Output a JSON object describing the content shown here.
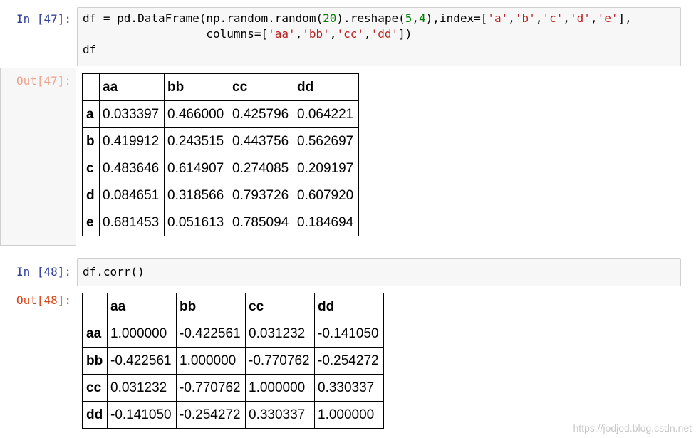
{
  "cell47": {
    "in_prompt": "In [47]:",
    "out_prompt": "Out[47]:",
    "code": {
      "l1_a": "df = pd.DataFrame(np.random.random(",
      "l1_num": "20",
      "l1_b": ").reshape(",
      "l1_n5": "5",
      "l1_comma": ",",
      "l1_n4": "4",
      "l1_c": "),index=[",
      "l1_sa": "'a'",
      "l1_s1": ",",
      "l1_sb": "'b'",
      "l1_s2": ",",
      "l1_sc": "'c'",
      "l1_s3": ",",
      "l1_sd": "'d'",
      "l1_s4": ",",
      "l1_se": "'e'",
      "l1_end": "],",
      "l2_a": "                  columns=[",
      "l2_aa": "'aa'",
      "l2_c1": ",",
      "l2_bb": "'bb'",
      "l2_c2": ",",
      "l2_cc": "'cc'",
      "l2_c3": ",",
      "l2_dd": "'dd'",
      "l2_end": "])",
      "l3": "df"
    },
    "table": {
      "columns": [
        "aa",
        "bb",
        "cc",
        "dd"
      ],
      "rows": [
        {
          "index": "a",
          "values": [
            "0.033397",
            "0.466000",
            "0.425796",
            "0.064221"
          ]
        },
        {
          "index": "b",
          "values": [
            "0.419912",
            "0.243515",
            "0.443756",
            "0.562697"
          ]
        },
        {
          "index": "c",
          "values": [
            "0.483646",
            "0.614907",
            "0.274085",
            "0.209197"
          ]
        },
        {
          "index": "d",
          "values": [
            "0.084651",
            "0.318566",
            "0.793726",
            "0.607920"
          ]
        },
        {
          "index": "e",
          "values": [
            "0.681453",
            "0.051613",
            "0.785094",
            "0.184694"
          ]
        }
      ]
    }
  },
  "cell48": {
    "in_prompt": "In [48]:",
    "out_prompt": "Out[48]:",
    "code": "df.corr()",
    "table": {
      "columns": [
        "aa",
        "bb",
        "cc",
        "dd"
      ],
      "rows": [
        {
          "index": "aa",
          "values": [
            "1.000000",
            "-0.422561",
            "0.031232",
            "-0.141050"
          ]
        },
        {
          "index": "bb",
          "values": [
            "-0.422561",
            "1.000000",
            "-0.770762",
            "-0.254272"
          ]
        },
        {
          "index": "cc",
          "values": [
            "0.031232",
            "-0.770762",
            "1.000000",
            "0.330337"
          ]
        },
        {
          "index": "dd",
          "values": [
            "-0.141050",
            "-0.254272",
            "0.330337",
            "1.000000"
          ]
        }
      ]
    }
  },
  "watermark": "https://jodjod.blog.csdn.net"
}
